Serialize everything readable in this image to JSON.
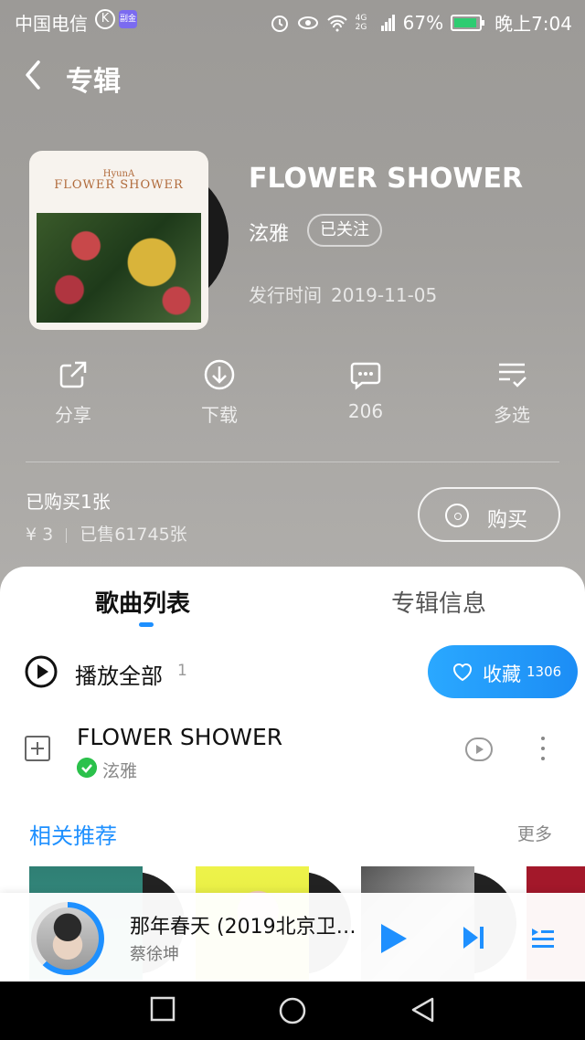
{
  "status_bar": {
    "carrier": "中国电信",
    "k_badge": "K",
    "sim2_badge": "副金",
    "network": "4G 2G",
    "battery": "67%",
    "time": "晚上7:04"
  },
  "header": {
    "title": "专辑"
  },
  "album": {
    "cover_artist_mark": "HyunA",
    "cover_title": "FLOWER SHOWER",
    "title": "FLOWER SHOWER",
    "artist": "泫雅",
    "follow_label": "已关注",
    "release_label": "发行时间",
    "release_date": "2019-11-05"
  },
  "actions": [
    {
      "label": "分享",
      "icon": "share-icon"
    },
    {
      "label": "下载",
      "icon": "download-icon"
    },
    {
      "label": "206",
      "icon": "comment-icon"
    },
    {
      "label": "多选",
      "icon": "multiselect-icon"
    }
  ],
  "purchase": {
    "bought": "已购买1张",
    "price": "¥ 3",
    "sold": "已售61745张",
    "buy_label": "购买"
  },
  "tabs": {
    "songs": "歌曲列表",
    "info": "专辑信息"
  },
  "playlist": {
    "play_all": "播放全部",
    "count": "1",
    "fav_label": "收藏",
    "fav_count": "1306"
  },
  "songs": [
    {
      "title": "FLOWER SHOWER",
      "artist": "泫雅"
    }
  ],
  "recommend": {
    "title": "相关推荐",
    "more": "更多"
  },
  "now_playing": {
    "title": "那年春天 (2019北京卫…",
    "artist": "蔡徐坤",
    "progress": 0.62
  },
  "colors": {
    "accent": "#1e90ff",
    "vip": "#2bc14b"
  }
}
